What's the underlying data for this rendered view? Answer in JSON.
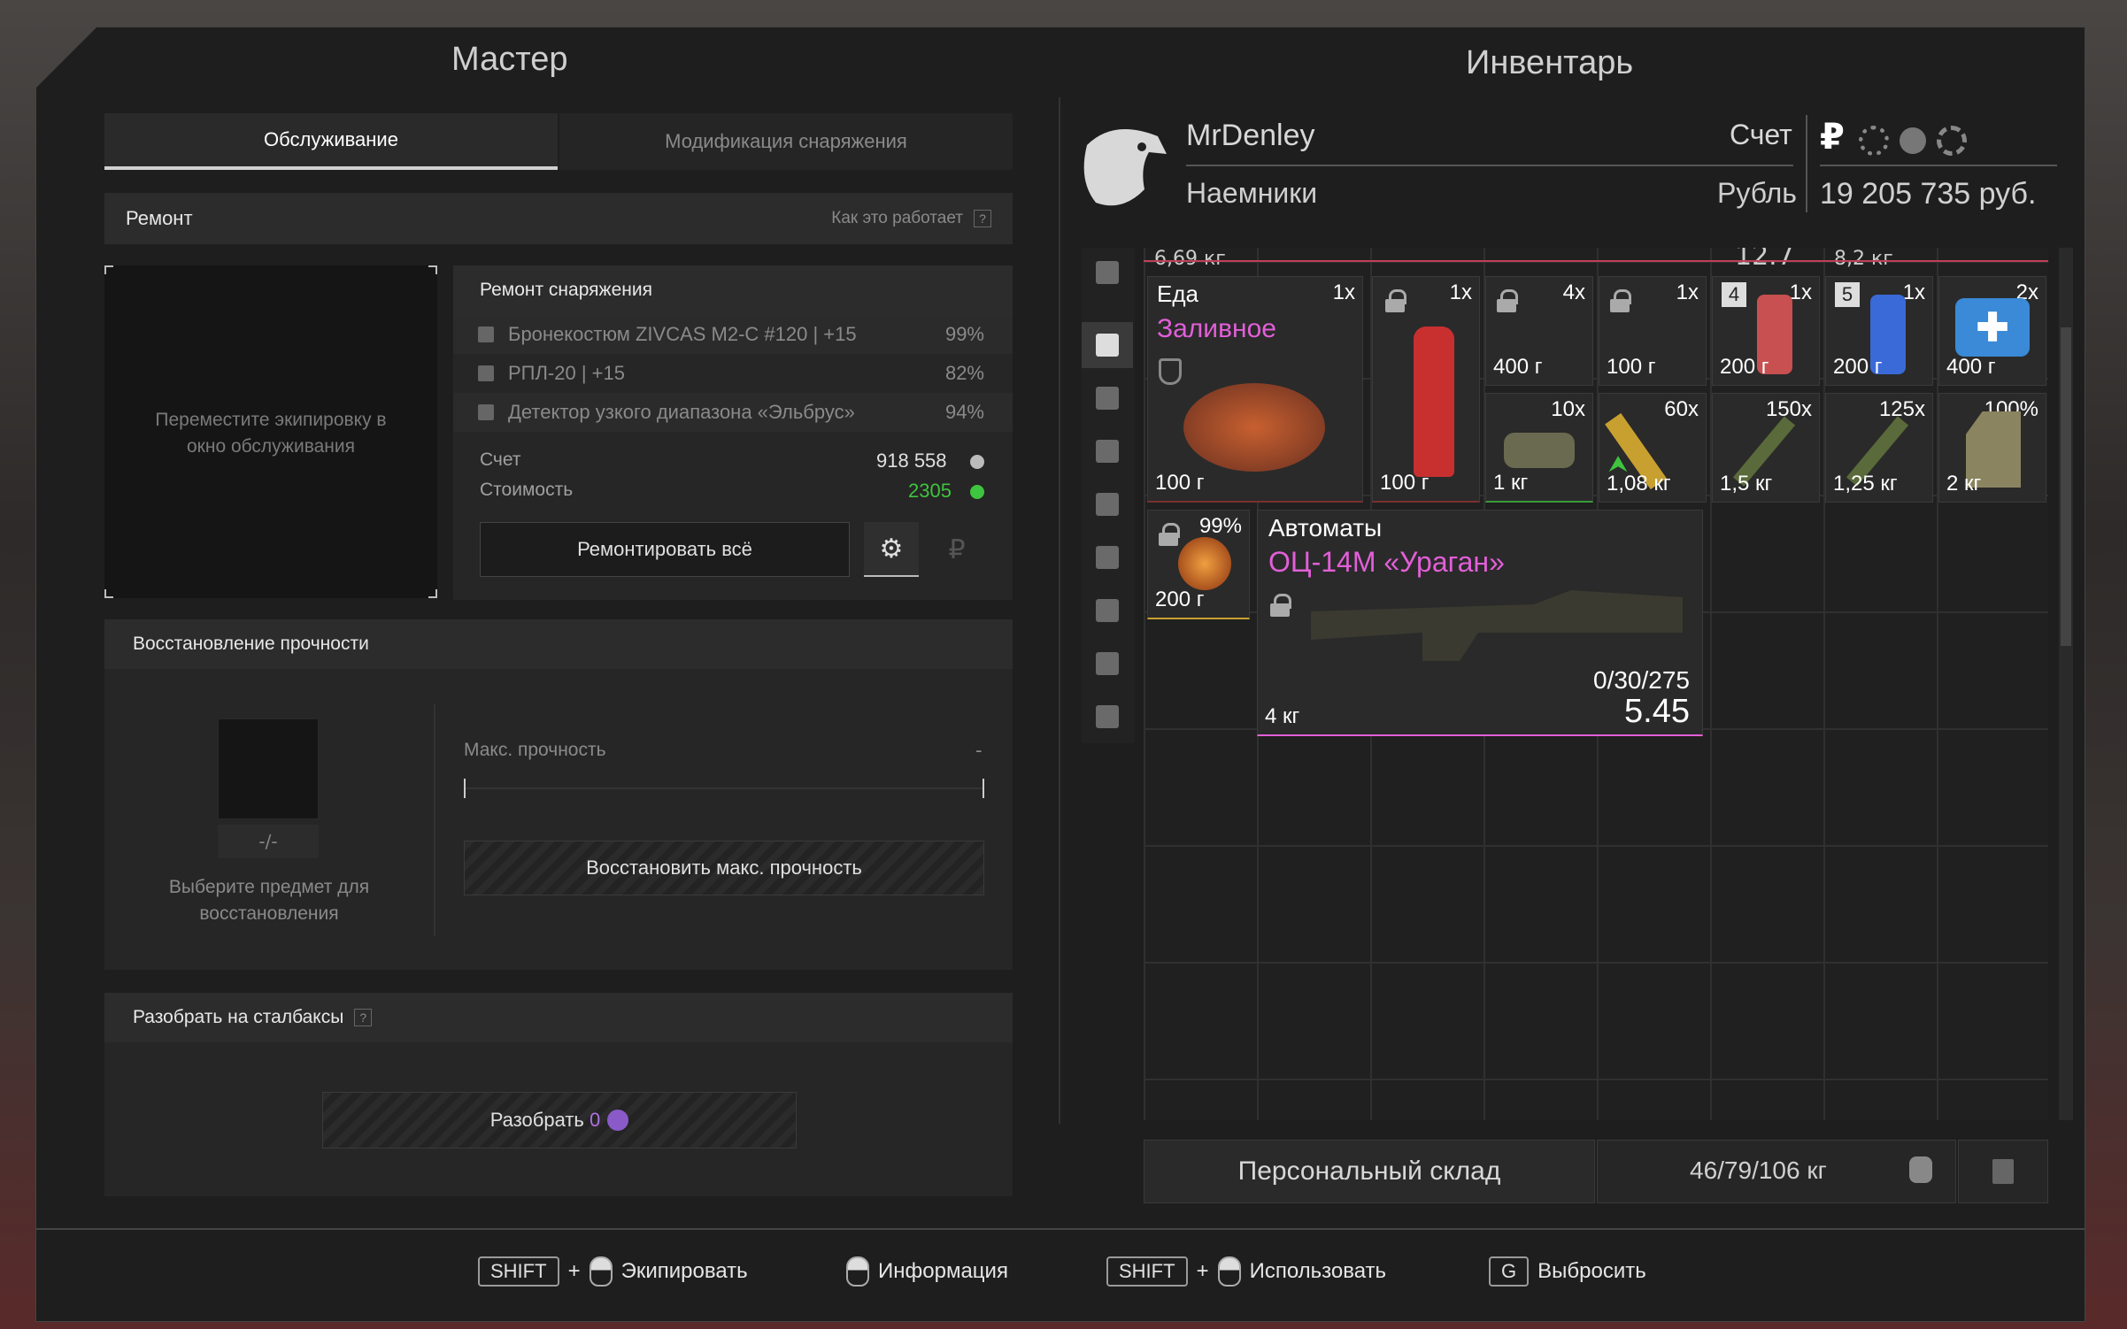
{
  "master": {
    "title": "Мастер",
    "tabs": [
      {
        "label": "Обслуживание",
        "active": true
      },
      {
        "label": "Модификация снаряжения",
        "active": false
      }
    ],
    "repair": {
      "header": "Ремонт",
      "how_it_works": "Как это работает",
      "qmark": "?",
      "drop_hint": "Переместите экипировку в окно обслуживания",
      "equip_header": "Ремонт снаряжения",
      "items": [
        {
          "name": "Бронекостюм ZIVCAS M2-C #120 | +15",
          "pct": "99%"
        },
        {
          "name": "РПЛ-20 | +15",
          "pct": "82%"
        },
        {
          "name": "Детектор узкого диапазона «Эльбрус»",
          "pct": "94%"
        }
      ],
      "account_label": "Счет",
      "account_value": "918 558",
      "cost_label": "Стоимость",
      "cost_value": "2305",
      "repair_all": "Ремонтировать всё",
      "ruble_symbol": "₽"
    },
    "restore": {
      "header": "Восстановление прочности",
      "counter": "-/-",
      "select_hint": "Выберите предмет для восстановления",
      "max_label": "Макс. прочность",
      "max_value": "-",
      "button": "Восстановить макс. прочность"
    },
    "disassemble": {
      "header": "Разобрать на сталбаксы",
      "qmark": "?",
      "button": "Разобрать",
      "count": "0"
    }
  },
  "inventory": {
    "title": "Инвентарь",
    "player": "MrDenley",
    "faction": "Наемники",
    "account_label": "Счет",
    "currency_label": "Рубль",
    "currency_symbol": "₽",
    "balance": "19 205 735 руб.",
    "items": [
      {
        "id": "food",
        "category": "Еда",
        "name": "Заливное",
        "qty": "1x",
        "weight": "100 г"
      },
      {
        "id": "vodka",
        "qty": "1x",
        "weight": "100 г"
      },
      {
        "id": "item3",
        "qty": "4x",
        "weight": "400 г"
      },
      {
        "id": "item4",
        "qty": "1x",
        "weight": "100 г"
      },
      {
        "id": "item5",
        "badge": "4",
        "qty": "1x",
        "weight": "200 г"
      },
      {
        "id": "item6",
        "badge": "5",
        "qty": "1x",
        "weight": "200 г"
      },
      {
        "id": "medkit",
        "qty": "2x",
        "weight": "400 г"
      },
      {
        "id": "bar",
        "qty": "10x",
        "weight": "1 кг"
      },
      {
        "id": "ammo1",
        "qty": "60x",
        "weight": "1,08 кг"
      },
      {
        "id": "ammo2",
        "qty": "150x",
        "weight": "1,5 кг"
      },
      {
        "id": "ammo3",
        "qty": "125x",
        "weight": "1,25 кг"
      },
      {
        "id": "plate",
        "qty": "100%",
        "weight": "2 кг"
      },
      {
        "id": "artifact",
        "qty": "99%",
        "weight": "200 г"
      },
      {
        "id": "rifle",
        "category": "Автоматы",
        "name": "ОЦ-14М «Ураган»",
        "ammo": "0/30/275",
        "caliber": "5.45",
        "weight": "4 кг"
      }
    ],
    "top_row": {
      "a": "6,69 кг",
      "b": "12.7",
      "c": "8,2 кг"
    },
    "stash_button": "Персональный склад",
    "weight": "46/79/106 кг"
  },
  "footer": [
    {
      "key": "SHIFT",
      "mouse": true,
      "label": "Экипировать"
    },
    {
      "key": "",
      "mouse": true,
      "label": "Информация"
    },
    {
      "key": "SHIFT",
      "mouse": true,
      "label": "Использовать"
    },
    {
      "key": "G",
      "mouse": false,
      "label": "Выбросить"
    }
  ],
  "colors": {
    "accent_pink": "#e25fd8",
    "green": "#3ec43e",
    "purple": "#b070e0"
  }
}
